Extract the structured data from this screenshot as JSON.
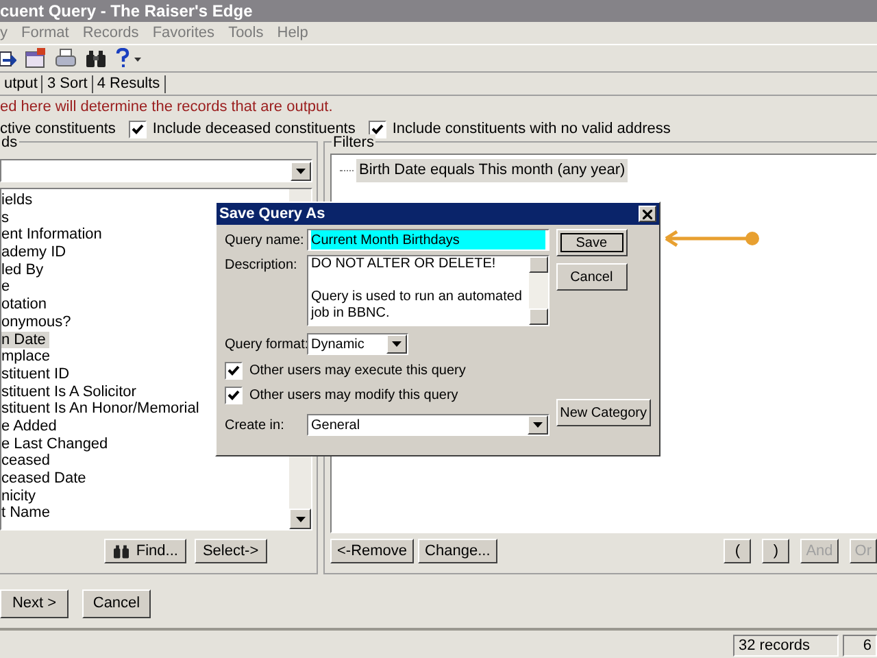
{
  "window": {
    "title": "cuent Query - The Raiser's Edge"
  },
  "menu": [
    "y",
    "Format",
    "Records",
    "Favorites",
    "Tools",
    "Help"
  ],
  "tabs": [
    {
      "label": "utput"
    },
    {
      "label": "3 Sort"
    },
    {
      "label": "4 Results"
    }
  ],
  "instruction": "ed here will determine the records that are output.",
  "options": [
    {
      "kind": "label",
      "label": "ctive constituents"
    },
    {
      "kind": "checkbox",
      "label": "Include deceased constituents",
      "checked": true
    },
    {
      "kind": "checkbox",
      "label": "Include constituents with no valid address",
      "checked": true
    }
  ],
  "fields": {
    "legend": "ds",
    "items": [
      {
        "label": "ields",
        "selected": false
      },
      {
        "label": "s",
        "selected": false
      },
      {
        "label": "ent Information",
        "selected": false
      },
      {
        "label": "ademy ID",
        "selected": false
      },
      {
        "label": "led By",
        "selected": false
      },
      {
        "label": "e",
        "selected": false
      },
      {
        "label": "otation",
        "selected": false
      },
      {
        "label": "onymous?",
        "selected": false
      },
      {
        "label": "n Date",
        "selected": true
      },
      {
        "label": "mplace",
        "selected": false
      },
      {
        "label": "stituent ID",
        "selected": false
      },
      {
        "label": "stituent Is A Solicitor",
        "selected": false
      },
      {
        "label": "stituent Is An Honor/Memorial",
        "selected": false
      },
      {
        "label": "e Added",
        "selected": false
      },
      {
        "label": "e Last Changed",
        "selected": false
      },
      {
        "label": "ceased",
        "selected": false
      },
      {
        "label": "ceased Date",
        "selected": false
      },
      {
        "label": "nicity",
        "selected": false
      },
      {
        "label": "t Name",
        "selected": false
      }
    ],
    "buttons": [
      "Find...",
      "Select->"
    ]
  },
  "filters": {
    "legend": "Filters",
    "items": [
      {
        "label": "Birth Date equals This month (any year)",
        "selected": true
      }
    ],
    "buttons": [
      {
        "label": "<-Remove",
        "disabled": false
      },
      {
        "label": "Change...",
        "disabled": false
      }
    ],
    "logic_buttons": [
      {
        "label": "(",
        "disabled": false
      },
      {
        "label": ")",
        "disabled": false
      },
      {
        "label": "And",
        "disabled": true
      },
      {
        "label": "Or",
        "disabled": true
      }
    ]
  },
  "nav_buttons": [
    "Next >",
    "Cancel"
  ],
  "status_bar": [
    "32 records",
    "6"
  ],
  "dialog": {
    "title": "Save Query As",
    "name_label": "Query name:",
    "name_value": "Current Month Birthdays",
    "name_selected": true,
    "description_label": "Description:",
    "description": "DO NOT ALTER OR DELETE!\n\nQuery is used to run an automated job in BBNC.",
    "format_label": "Query format:",
    "format_value": "Dynamic",
    "checkboxes": [
      {
        "label": "Other users may execute this query",
        "checked": true
      },
      {
        "label": "Other users may modify this query",
        "checked": true
      }
    ],
    "create_label": "Create in:",
    "create_value": "General",
    "buttons": [
      {
        "label": "Save",
        "default": true
      },
      {
        "label": "Cancel",
        "default": false
      }
    ],
    "category_button": "New Category"
  }
}
